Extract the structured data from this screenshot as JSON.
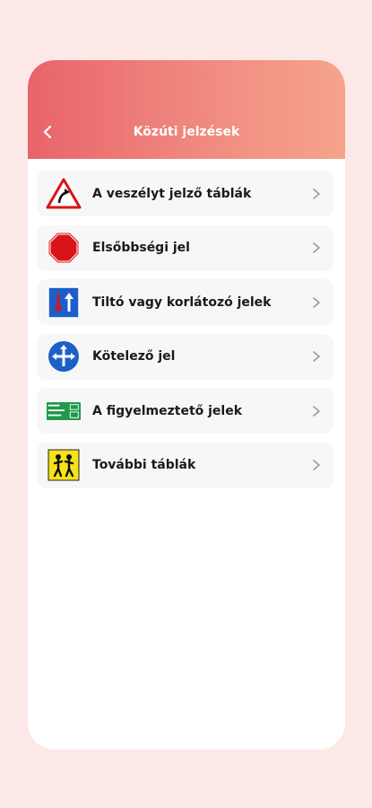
{
  "header": {
    "title": "Közúti jelzések",
    "back_icon": "chevron-left-icon"
  },
  "colors": {
    "background": "#fde8e8",
    "header_start": "#e8646a",
    "header_end": "#f6a48c",
    "item_bg": "#f7f7f8"
  },
  "categories": [
    {
      "label": "A veszélyt jelző táblák",
      "icon": "curve-warning-sign-icon"
    },
    {
      "label": "Elsőbbségi jel",
      "icon": "stop-sign-icon"
    },
    {
      "label": "Tiltó vagy korlátozó jelek",
      "icon": "priority-arrows-sign-icon"
    },
    {
      "label": "Kötelező jel",
      "icon": "mandatory-directions-sign-icon"
    },
    {
      "label": "A figyelmeztető jelek",
      "icon": "green-info-board-icon"
    },
    {
      "label": "További táblák",
      "icon": "children-crossing-sign-icon"
    }
  ]
}
